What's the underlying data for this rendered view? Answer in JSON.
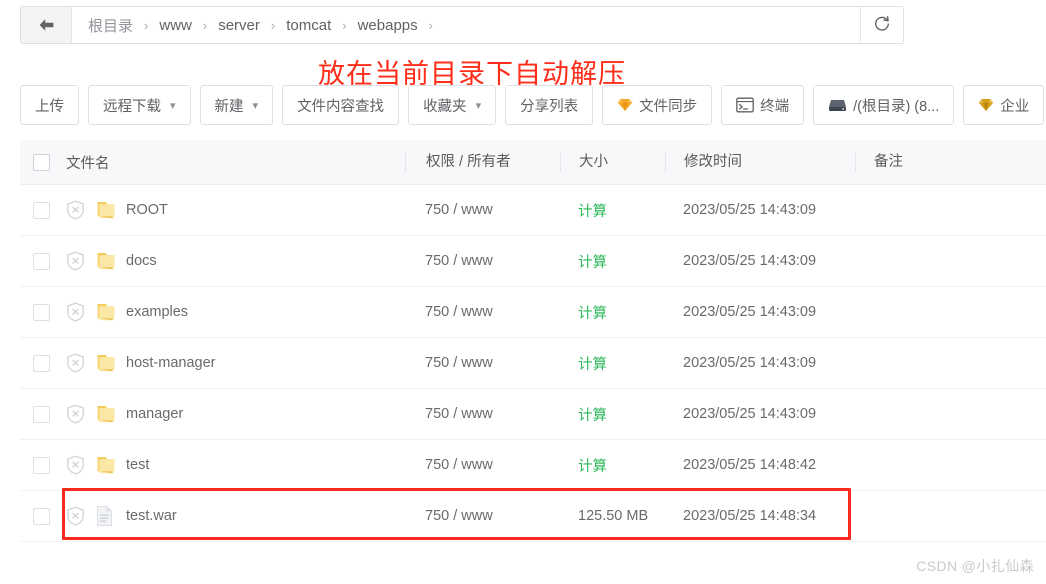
{
  "breadcrumb": {
    "back_icon": "arrow-left-icon",
    "refresh_icon": "refresh-icon",
    "separator": "›",
    "items": [
      {
        "label": "根目录"
      },
      {
        "label": "www"
      },
      {
        "label": "server"
      },
      {
        "label": "tomcat"
      },
      {
        "label": "webapps"
      }
    ]
  },
  "annotation": {
    "text": "放在当前目录下自动解压",
    "color": "#ff2d1a"
  },
  "toolbar": {
    "buttons": [
      {
        "label": "上传",
        "caret": false,
        "icon": null
      },
      {
        "label": "远程下载",
        "caret": true,
        "icon": null
      },
      {
        "label": "新建",
        "caret": true,
        "icon": null
      },
      {
        "label": "文件内容查找",
        "caret": false,
        "icon": null
      },
      {
        "label": "收藏夹",
        "caret": true,
        "icon": null
      },
      {
        "label": "分享列表",
        "caret": false,
        "icon": null
      },
      {
        "label": "文件同步",
        "caret": false,
        "icon": "diamond-icon"
      },
      {
        "label": "终端",
        "caret": false,
        "icon": "terminal-icon"
      },
      {
        "label": "/(根目录) (8...",
        "caret": false,
        "icon": "disk-icon"
      },
      {
        "label": "企业",
        "caret": false,
        "icon": "diamond-icon"
      }
    ]
  },
  "table": {
    "headers": {
      "name": "文件名",
      "permission": "权限 / 所有者",
      "size": "大小",
      "modified": "修改时间",
      "note": "备注"
    },
    "rows": [
      {
        "name": "ROOT",
        "icon": "folder-icon",
        "permission": "750 / www",
        "size": "计算",
        "size_is_link": true,
        "modified": "2023/05/25 14:43:09",
        "note": ""
      },
      {
        "name": "docs",
        "icon": "folder-icon",
        "permission": "750 / www",
        "size": "计算",
        "size_is_link": true,
        "modified": "2023/05/25 14:43:09",
        "note": ""
      },
      {
        "name": "examples",
        "icon": "folder-icon",
        "permission": "750 / www",
        "size": "计算",
        "size_is_link": true,
        "modified": "2023/05/25 14:43:09",
        "note": ""
      },
      {
        "name": "host-manager",
        "icon": "folder-icon",
        "permission": "750 / www",
        "size": "计算",
        "size_is_link": true,
        "modified": "2023/05/25 14:43:09",
        "note": ""
      },
      {
        "name": "manager",
        "icon": "folder-icon",
        "permission": "750 / www",
        "size": "计算",
        "size_is_link": true,
        "modified": "2023/05/25 14:43:09",
        "note": ""
      },
      {
        "name": "test",
        "icon": "folder-icon",
        "permission": "750 / www",
        "size": "计算",
        "size_is_link": true,
        "modified": "2023/05/25 14:48:42",
        "note": ""
      },
      {
        "name": "test.war",
        "icon": "file-icon",
        "permission": "750 / www",
        "size": "125.50 MB",
        "size_is_link": false,
        "modified": "2023/05/25 14:48:34",
        "note": ""
      }
    ]
  },
  "watermark": {
    "text": "CSDN @小扎仙森"
  }
}
